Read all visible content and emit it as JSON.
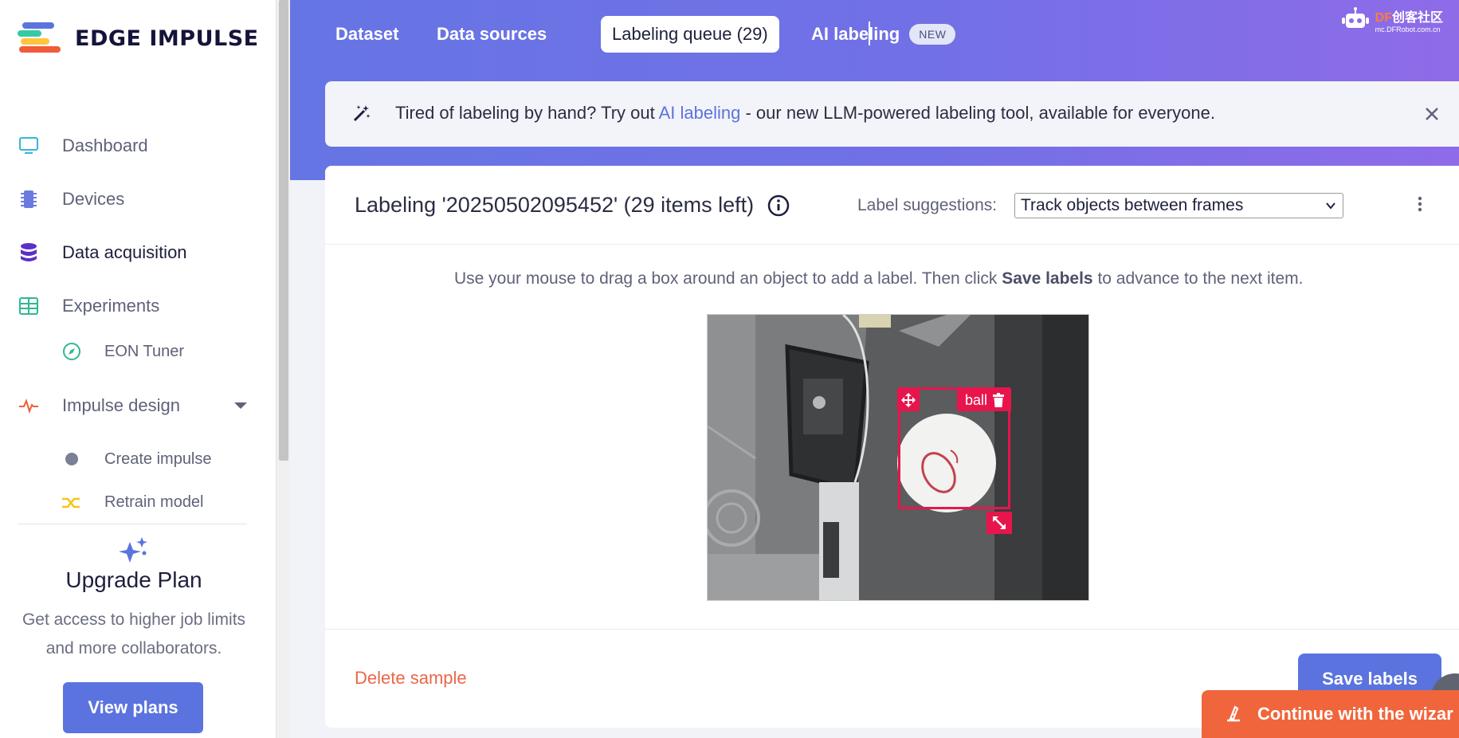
{
  "brand": {
    "name": "EDGE IMPULSE",
    "logo_colors": [
      "#f05d3b",
      "#ffc53d",
      "#36c9a6",
      "#5a73de"
    ]
  },
  "sidebar": {
    "items": [
      {
        "label": "Dashboard",
        "icon": "monitor-icon"
      },
      {
        "label": "Devices",
        "icon": "chip-icon"
      },
      {
        "label": "Data acquisition",
        "icon": "database-icon",
        "active": true
      },
      {
        "label": "Experiments",
        "icon": "grid-icon"
      },
      {
        "label": "EON Tuner",
        "icon": "compass-icon",
        "sub": true
      },
      {
        "label": "Impulse design",
        "icon": "pulse-icon",
        "expandable": true
      },
      {
        "label": "Create impulse",
        "icon": "dot-icon",
        "sub": true
      },
      {
        "label": "Retrain model",
        "icon": "shuffle-icon",
        "sub": true,
        "partially_visible": true
      }
    ],
    "upgrade": {
      "title": "Upgrade Plan",
      "description": "Get access to higher job limits and more collaborators.",
      "button": "View plans"
    }
  },
  "header": {
    "tabs": [
      {
        "label": "Dataset"
      },
      {
        "label": "Data sources"
      },
      {
        "label": "Labeling queue (29)",
        "selected": true
      },
      {
        "label": "AI labeling",
        "badge": "NEW"
      }
    ],
    "watermark": {
      "brand_prefix": "DF",
      "brand_text": "创客社区",
      "url": "mc.DFRobot.com.cn"
    }
  },
  "banner": {
    "text_before": "Tired of labeling by hand? Try out ",
    "link": "AI labeling",
    "text_after": " - our new LLM-powered labeling tool, available for everyone."
  },
  "labeling": {
    "title": "Labeling '20250502095452' (29 items left)",
    "suggestions_label": "Label suggestions:",
    "suggestions_value": "Track objects between frames",
    "instruction_before": "Use your mouse to drag a box around an object to add a label. Then click ",
    "instruction_bold": "Save labels",
    "instruction_after": " to advance to the next item.",
    "box_label": "ball",
    "delete_label": "Delete sample",
    "save_label": "Save labels"
  },
  "wizard": {
    "label": "Continue with the wizar"
  },
  "colors": {
    "accent": "#5a73de",
    "danger": "#e8154c",
    "wizard": "#f0653b",
    "delete": "#e8684a"
  }
}
